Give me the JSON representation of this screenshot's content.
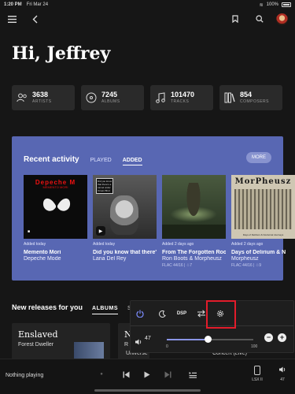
{
  "status": {
    "time": "1:20 PM",
    "date": "Fri Mar 24",
    "battery": "100%"
  },
  "greeting": "Hi, Jeffrey",
  "stats": [
    {
      "num": "3638",
      "label": "ARTISTS"
    },
    {
      "num": "7245",
      "label": "ALBUMS"
    },
    {
      "num": "101470",
      "label": "TRACKS"
    },
    {
      "num": "854",
      "label": "COMPOSERS"
    }
  ],
  "recent": {
    "title": "Recent activity",
    "tabs": [
      "PLAYED",
      "ADDED"
    ],
    "more": "MORE",
    "cards": [
      {
        "added": "Added today",
        "title": "Memento Mori",
        "artist": "Depeche Mode",
        "meta": ""
      },
      {
        "added": "Added today",
        "title": "Did you know that there's a",
        "artist": "Lana Del Rey",
        "meta": ""
      },
      {
        "added": "Added 2 days ago",
        "title": "From The Forgotten Rooms",
        "artist": "Ron Boots & Morpheusz",
        "meta": "FLAC 44/16 | ♧7"
      },
      {
        "added": "Added 2 days ago",
        "title": "Days of Delirium & N",
        "artist": "Morpheusz",
        "meta": "FLAC 44/16 | ♧9"
      }
    ],
    "cover_text": {
      "c1_band": "Depeche M",
      "c1_sub": "MEMENTO MORI",
      "c2_box": "Did you know that there's a tunnel under Ocean Blvd",
      "c4_title": "MorPheusz",
      "c4_caption": "Days of Delirium & Nocturnal Journeys"
    }
  },
  "new_releases": {
    "title": "New releases for you",
    "tabs": [
      "ALBUMS",
      "SI"
    ],
    "cards": [
      {
        "title": "Enslaved",
        "artist": "Forest Dweller"
      },
      {
        "title": "N",
        "artist": "R"
      }
    ],
    "partial": [
      "Universe",
      "Concert (Live)"
    ]
  },
  "popup": {
    "dsp": "DSP",
    "volume": "47",
    "volume_level": 0.47,
    "min": "0",
    "max": "100"
  },
  "player": {
    "now_playing": "Nothing playing",
    "zone": "LSX II",
    "volume": "47"
  }
}
